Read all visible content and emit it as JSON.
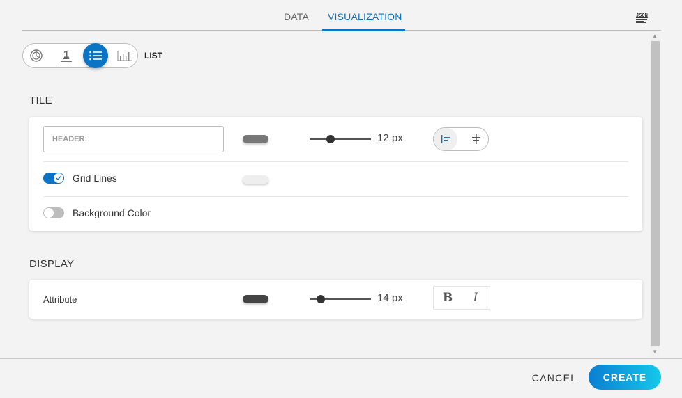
{
  "tabs": [
    {
      "label": "DATA",
      "active": false
    },
    {
      "label": "VISUALIZATION",
      "active": true
    }
  ],
  "json_button": {
    "label": "JSON",
    "icon": "json-icon"
  },
  "visualization_types": {
    "options": [
      {
        "id": "pie",
        "icon": "pie-chart-icon",
        "active": false
      },
      {
        "id": "number",
        "icon": "number-icon",
        "label": "1",
        "active": false
      },
      {
        "id": "list",
        "icon": "list-icon",
        "active": true
      },
      {
        "id": "bar",
        "icon": "bar-chart-icon",
        "active": false
      }
    ],
    "selected_label": "LIST"
  },
  "tile": {
    "title": "TILE",
    "header": {
      "placeholder": "HEADER:",
      "value": ""
    },
    "header_color": "#777777",
    "header_font_size": {
      "value": 12,
      "label": "12 px",
      "min": 8,
      "max": 48
    },
    "alignment": {
      "options": [
        "left",
        "center"
      ],
      "selected": "left"
    },
    "grid_lines": {
      "label": "Grid Lines",
      "enabled": true,
      "color": "#eeeeee"
    },
    "background_color": {
      "label": "Background Color",
      "enabled": false
    }
  },
  "display": {
    "title": "DISPLAY",
    "attribute": {
      "label": "Attribute",
      "color": "#444444",
      "font_size": {
        "value": 14,
        "label": "14 px",
        "min": 8,
        "max": 48
      },
      "bold_label": "B",
      "italic_label": "I"
    }
  },
  "footer": {
    "cancel_label": "CANCEL",
    "create_label": "CREATE"
  },
  "colors": {
    "accent": "#0b74c4",
    "create_gradient_start": "#0a7fd1",
    "create_gradient_end": "#14c8ea"
  }
}
